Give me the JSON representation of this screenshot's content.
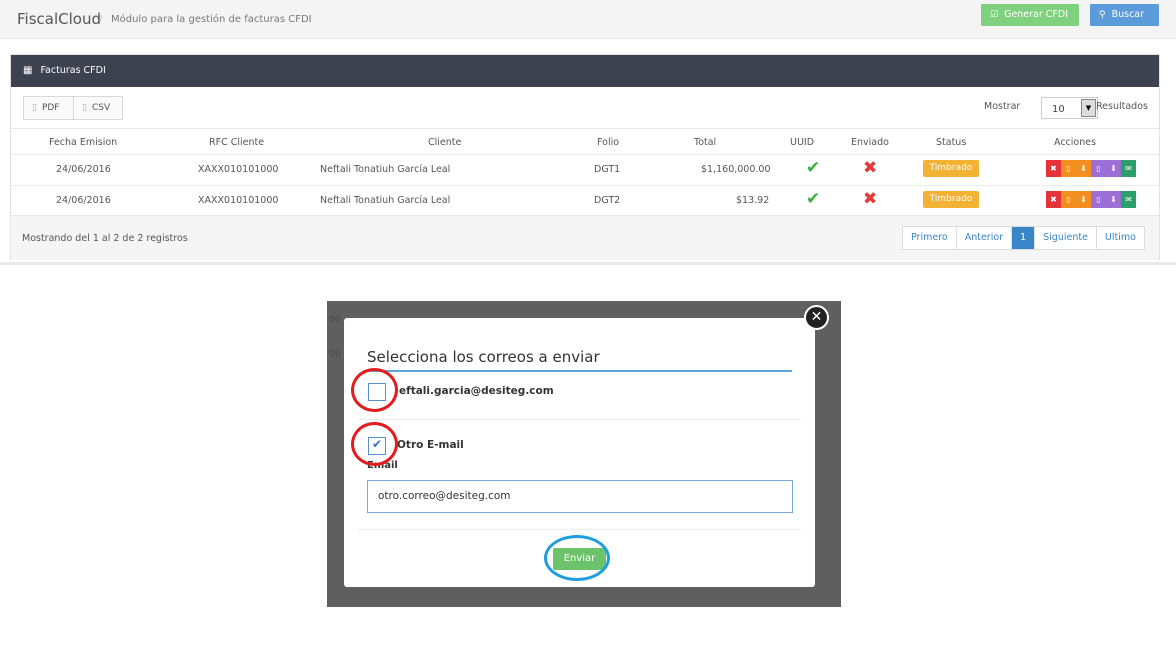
{
  "topbar": {
    "brand": "FiscalCloud",
    "separator": "/",
    "subtitle": "Módulo para la gestión de facturas CFDI",
    "generate_label": "Generar CFDI",
    "search_label": "Buscar"
  },
  "panel": {
    "title": "Facturas CFDI",
    "export_pdf": "PDF",
    "export_csv": "CSV",
    "show_label": "Mostrar",
    "page_size": "10",
    "results_label": "Resultados"
  },
  "table": {
    "headers": [
      "Fecha Emision",
      "RFC Cliente",
      "Cliente",
      "Folio",
      "Total",
      "UUID",
      "Enviado",
      "Status",
      "Acciones"
    ],
    "rows": [
      {
        "fecha": "24/06/2016",
        "rfc": "XAXX010101000",
        "cliente": "Neftali Tonatiuh García Leal",
        "folio": "DGT1",
        "total": "$1,160,000.00",
        "status": "Timbrado"
      },
      {
        "fecha": "24/06/2016",
        "rfc": "XAXX010101000",
        "cliente": "Neftali Tonatiuh García Leal",
        "folio": "DGT2",
        "total": "$13.92",
        "status": "Timbrado"
      }
    ]
  },
  "footer": {
    "showing": "Mostrando del 1 al 2 de 2 registros",
    "pages": [
      "Primero",
      "Anterior",
      "1",
      "Siguiente",
      "Ultimo"
    ]
  },
  "modal": {
    "title": "Selecciona los correos a enviar",
    "email_option": "neftali.garcia@desiteg.com",
    "email_option_visible": "eftali.garcia@desiteg.com",
    "other_option": "Otro E-mail",
    "email_label": "Email",
    "email_label_visible": "Email",
    "email_value": "otro.correo@desiteg.com",
    "send_label": "Enviar"
  },
  "colors": {
    "header_dark": "#3d4150",
    "green": "#7fd17f",
    "blue": "#5b9bd9",
    "badge": "#f3b234",
    "red_circle": "#e21d1d",
    "blue_circle": "#1e9de1"
  }
}
